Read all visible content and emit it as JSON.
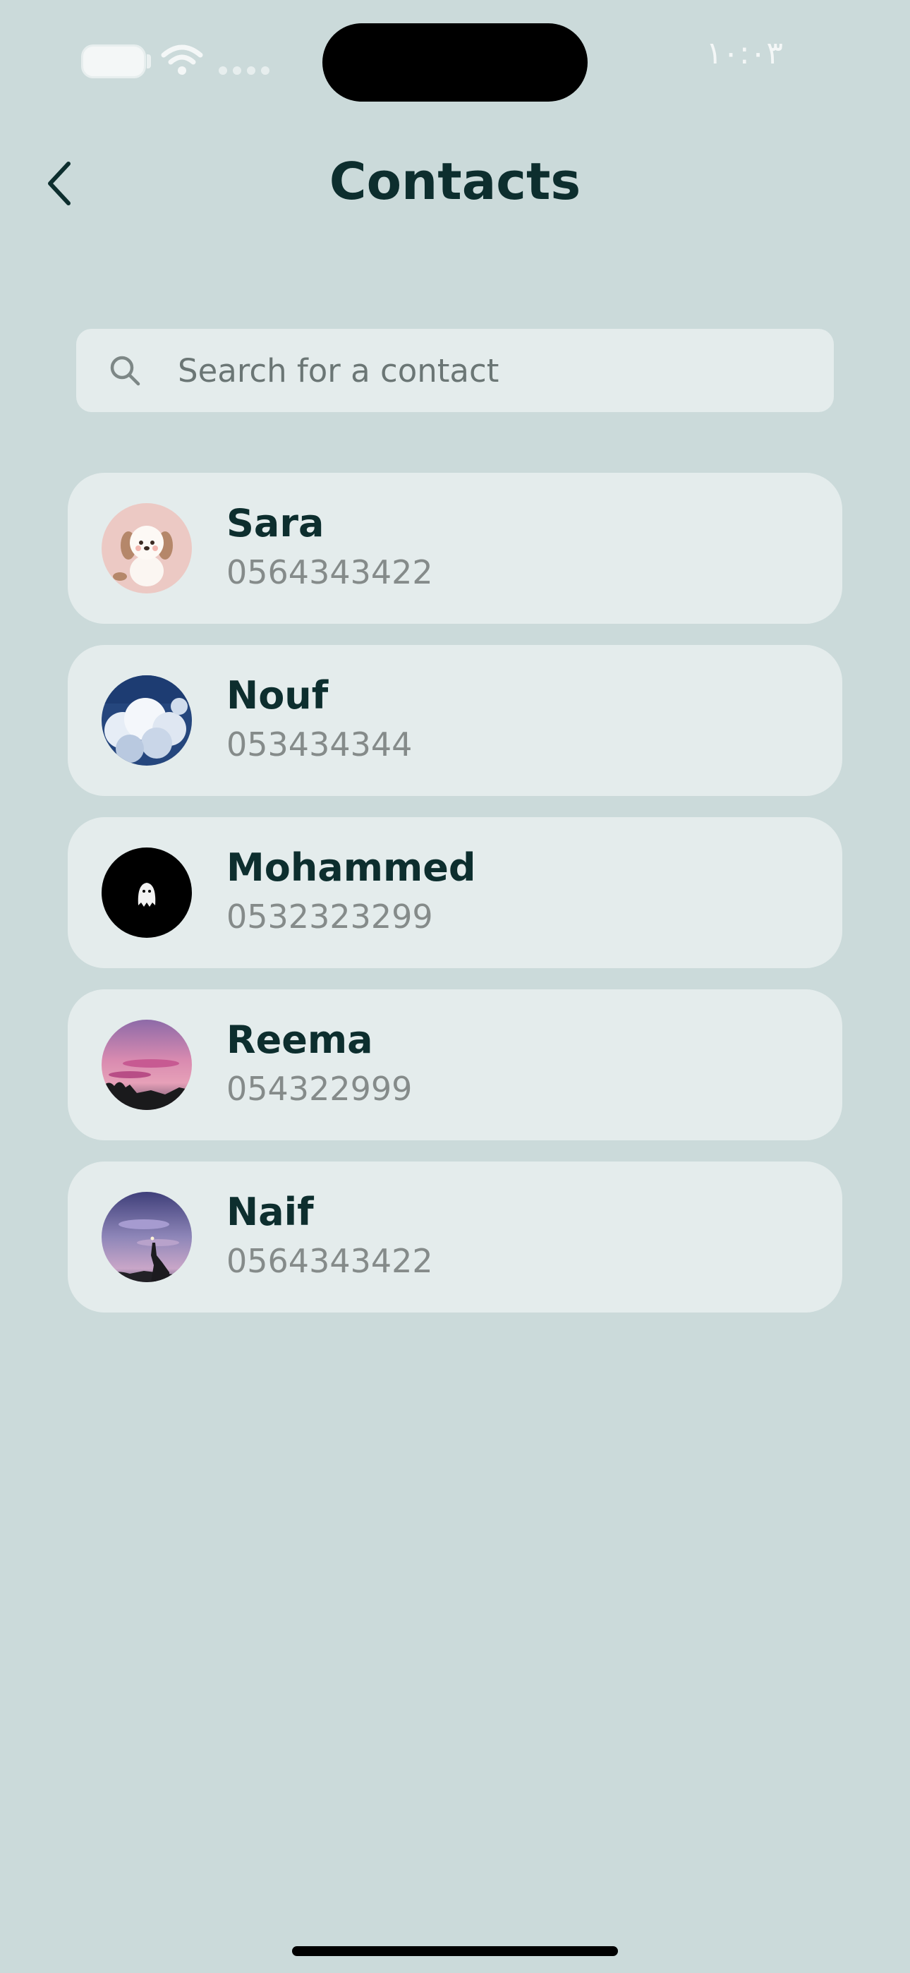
{
  "status_bar": {
    "time": "١٠:٠٣"
  },
  "header": {
    "title": "Contacts",
    "back_icon": "chevron-left-icon"
  },
  "search": {
    "placeholder": "Search for a contact",
    "value": "",
    "icon": "search-icon"
  },
  "contacts": [
    {
      "name": "Sara",
      "phone": "0564343422",
      "avatar": "puppy-avatar"
    },
    {
      "name": "Nouf",
      "phone": "053434344",
      "avatar": "clouds-avatar"
    },
    {
      "name": "Mohammed",
      "phone": "0532323299",
      "avatar": "ghost-avatar"
    },
    {
      "name": "Reema",
      "phone": "054322999",
      "avatar": "sunset-avatar"
    },
    {
      "name": "Naif",
      "phone": "0564343422",
      "avatar": "night-sky-avatar"
    }
  ],
  "colors": {
    "background": "#cbdada",
    "card": "#e4ecec",
    "title_text": "#0d2e2e",
    "phone_text": "#858b8a"
  }
}
